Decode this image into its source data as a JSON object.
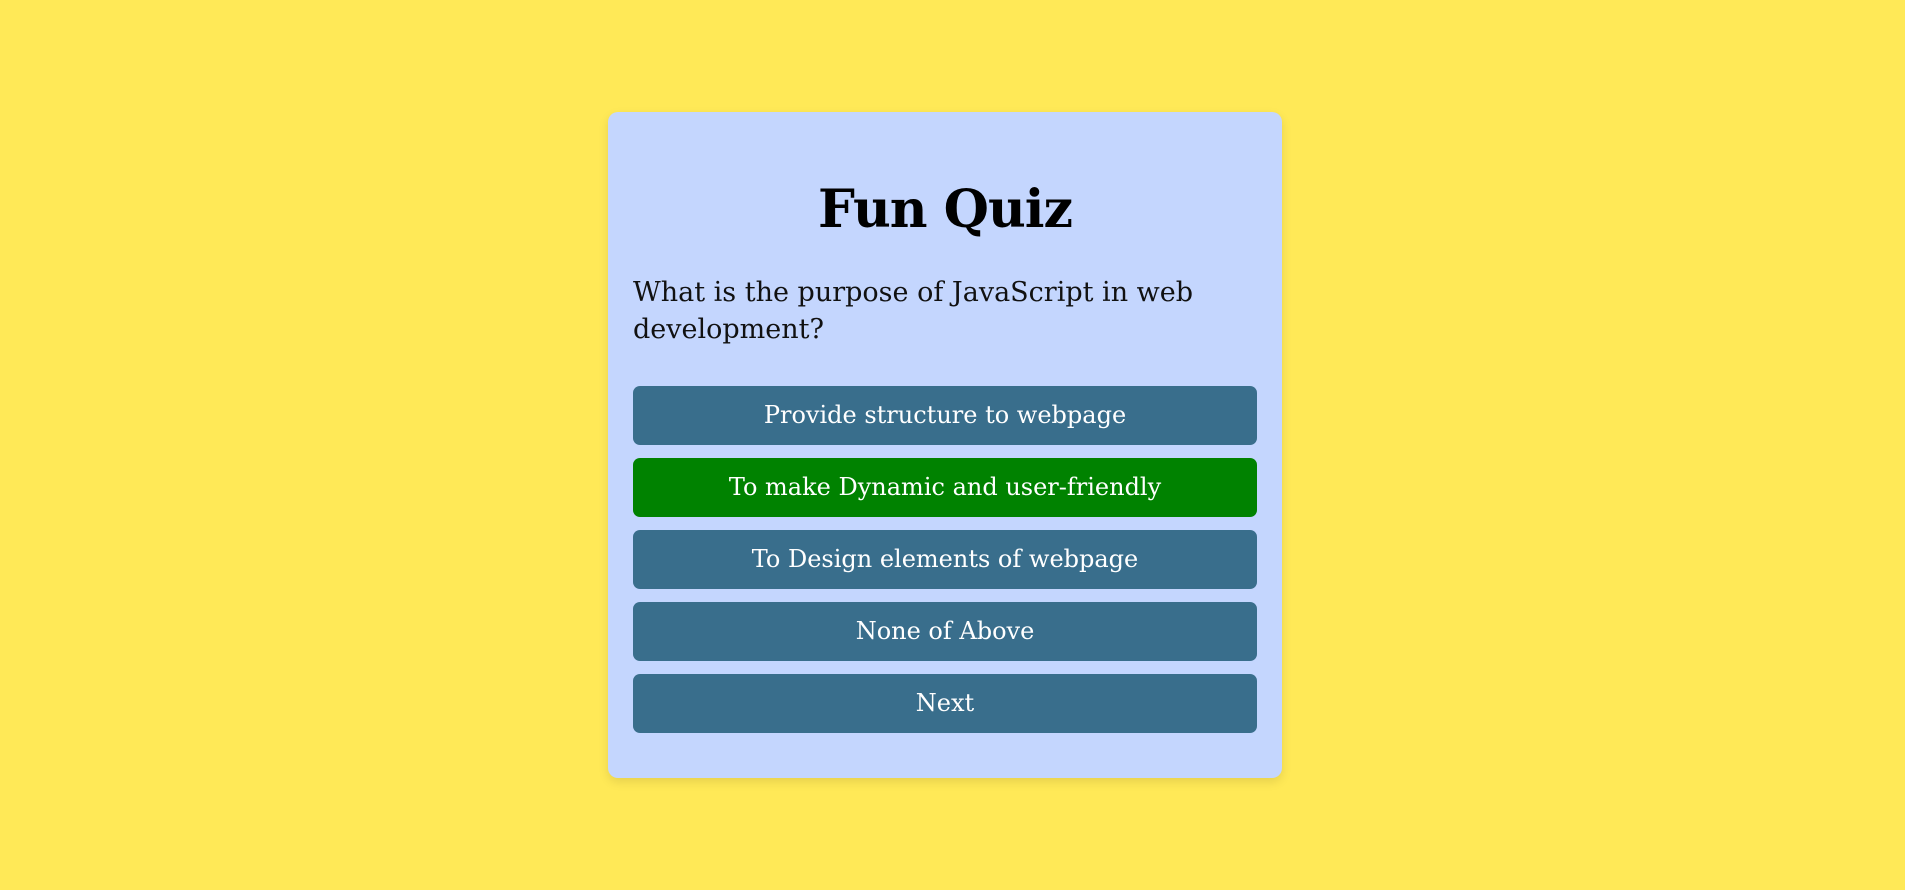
{
  "quiz": {
    "title": "Fun Quiz",
    "question": "What is the purpose of JavaScript in web development?",
    "answers": [
      {
        "label": "Provide structure to webpage",
        "state": "default"
      },
      {
        "label": "To make Dynamic and user-friendly",
        "state": "correct"
      },
      {
        "label": "To Design elements of webpage",
        "state": "default"
      },
      {
        "label": "None of Above",
        "state": "default"
      }
    ],
    "next_label": "Next"
  },
  "colors": {
    "page_background": "#ffe957",
    "card_background": "#c4d6fe",
    "button_default": "#396e8c",
    "button_correct": "#008200",
    "button_text": "#ffffff"
  }
}
